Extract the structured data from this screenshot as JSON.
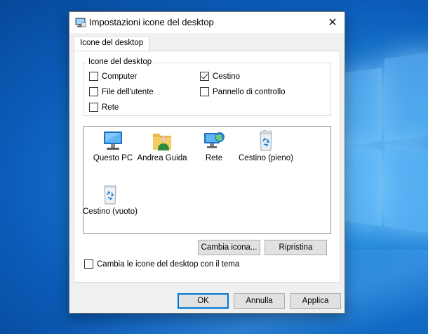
{
  "window": {
    "title": "Impostazioni icone del desktop",
    "close_glyph": "✕"
  },
  "tabs": [
    {
      "label": "Icone del desktop"
    }
  ],
  "group": {
    "label": "Icone del desktop",
    "checkboxes": [
      {
        "label": "Computer",
        "checked": false
      },
      {
        "label": "Cestino",
        "checked": true
      },
      {
        "label": "File dell'utente",
        "checked": false
      },
      {
        "label": "Pannello di controllo",
        "checked": false
      },
      {
        "label": "Rete",
        "checked": false
      }
    ]
  },
  "icons": [
    {
      "label": "Questo PC",
      "icon": "computer-icon"
    },
    {
      "label": "Andrea Guida",
      "icon": "user-folder-icon"
    },
    {
      "label": "Rete",
      "icon": "network-icon"
    },
    {
      "label": "Cestino (pieno)",
      "icon": "recycle-bin-full-icon"
    },
    {
      "label": "Cestino (vuoto)",
      "icon": "recycle-bin-empty-icon"
    }
  ],
  "buttons": {
    "change_icon": "Cambia icona...",
    "restore": "Ripristina",
    "ok": "OK",
    "cancel": "Annulla",
    "apply": "Applica"
  },
  "theme_checkbox": {
    "label": "Cambia le icone del desktop con il tema",
    "checked": false
  },
  "colors": {
    "desktop": "#0b5cb8",
    "accent": "#0078d7"
  }
}
